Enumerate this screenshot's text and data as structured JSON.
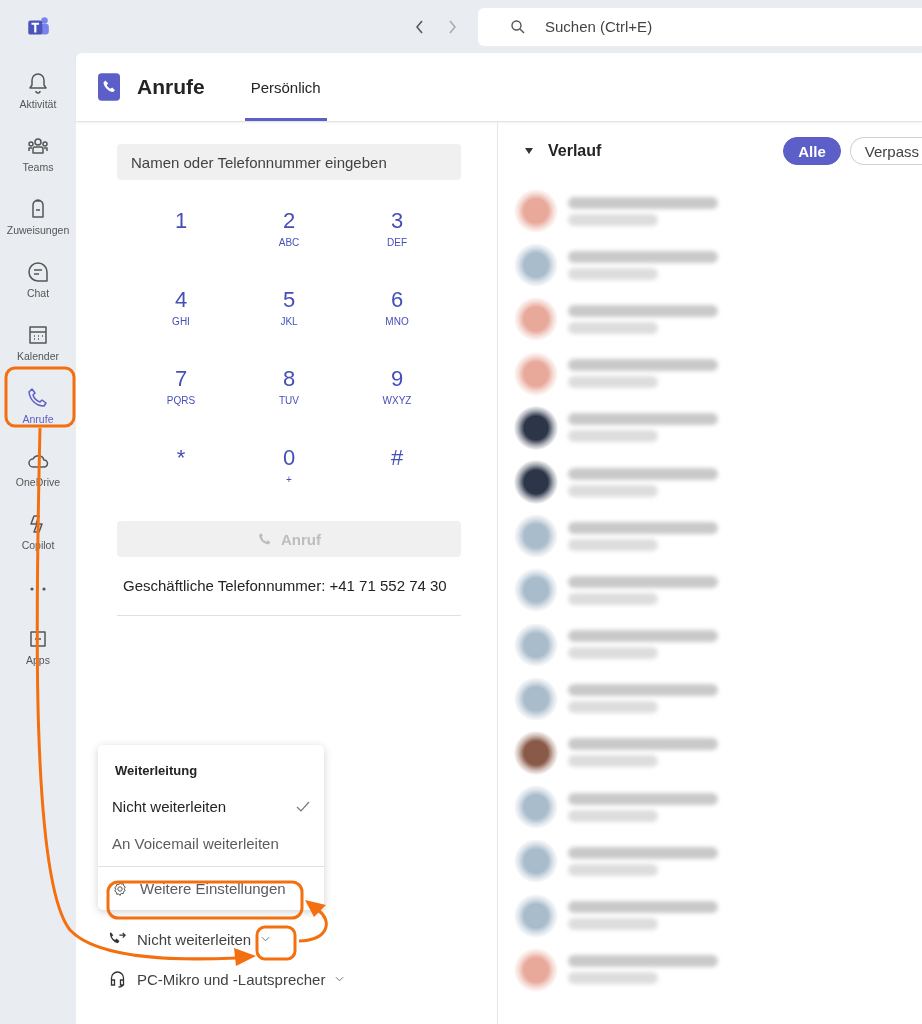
{
  "top_bar": {
    "search": {
      "placeholder": "Suchen (Ctrl+E)"
    }
  },
  "sidebar": {
    "items": [
      {
        "label": "Aktivität",
        "selected": false
      },
      {
        "label": "Teams",
        "selected": false
      },
      {
        "label": "Zuweisungen",
        "selected": false
      },
      {
        "label": "Chat",
        "selected": false
      },
      {
        "label": "Kalender",
        "selected": false
      },
      {
        "label": "Anrufe",
        "selected": true
      },
      {
        "label": "OneDrive",
        "selected": false
      },
      {
        "label": "Copilot",
        "selected": false
      },
      {
        "kind": "more"
      },
      {
        "label": "Apps",
        "selected": false
      }
    ]
  },
  "header": {
    "title": "Anrufe",
    "tabs": [
      {
        "label": "Persönlich",
        "selected": true
      }
    ]
  },
  "dialpad": {
    "input": {
      "placeholder": "Namen oder Telefonnummer eingeben"
    },
    "keys": [
      {
        "digit": "1"
      },
      {
        "digit": "2",
        "letters": "ABC"
      },
      {
        "digit": "3",
        "letters": "DEF"
      },
      {
        "digit": "4",
        "letters": "GHI"
      },
      {
        "digit": "5",
        "letters": "JKL"
      },
      {
        "digit": "6",
        "letters": "MNO"
      },
      {
        "digit": "7",
        "letters": "PQRS"
      },
      {
        "digit": "8",
        "letters": "TUV"
      },
      {
        "digit": "9",
        "letters": "WXYZ"
      },
      {
        "digit": "*"
      },
      {
        "digit": "0",
        "letters": "+"
      },
      {
        "digit": "#"
      }
    ],
    "call_button": {
      "label": "Anruf",
      "disabled": true
    },
    "business_number": "Geschäftliche Telefonnummer: +41 71 552 74 30"
  },
  "forwarding_menu": {
    "title": "Weiterleitung",
    "options": [
      {
        "label": "Nicht weiterleiten",
        "selected": true
      },
      {
        "label": "An Voicemail weiterleiten",
        "selected": false
      }
    ],
    "more_settings": "Weitere Einstellungen"
  },
  "forwarding": {
    "label": "Nicht weiterleiten"
  },
  "audio_device": {
    "label": "PC-Mikro und -Lautsprecher"
  },
  "history": {
    "title": "Verlauf",
    "filters": [
      {
        "label": "Alle",
        "selected": true
      },
      {
        "label": "Verpass",
        "selected": false
      }
    ],
    "rows": [
      {
        "color": "#e8a89a"
      },
      {
        "color": "#a9bccb"
      },
      {
        "color": "#e8a89a"
      },
      {
        "color": "#e8a89a"
      },
      {
        "color": "#2d3648"
      },
      {
        "color": "#2d3648"
      },
      {
        "color": "#a9bccb"
      },
      {
        "color": "#a9bccb"
      },
      {
        "color": "#a9bccb"
      },
      {
        "color": "#a9bccb"
      },
      {
        "color": "#8a5a48"
      },
      {
        "color": "#a9bccb"
      },
      {
        "color": "#a9bccb"
      },
      {
        "color": "#a9bccb"
      },
      {
        "color": "#e8a89a"
      }
    ]
  }
}
